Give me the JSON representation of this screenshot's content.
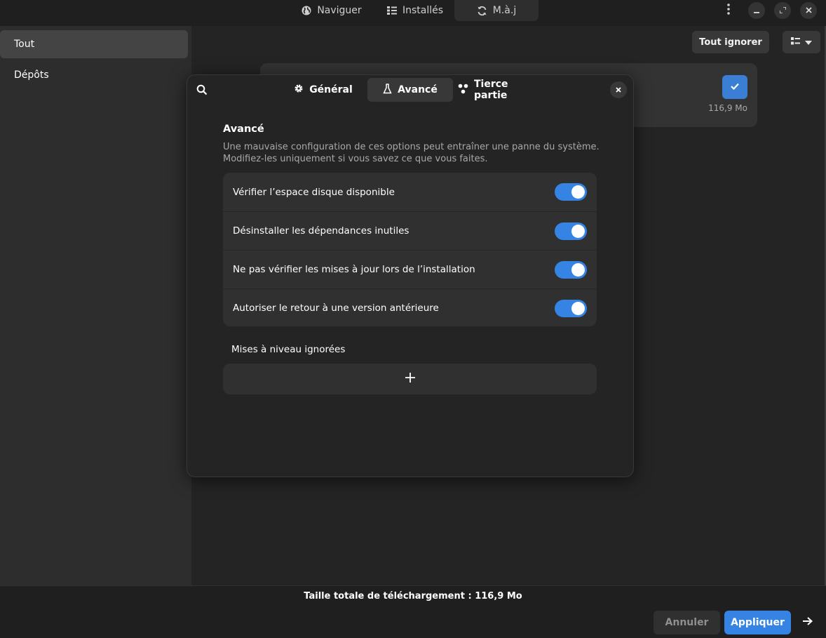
{
  "header": {
    "tabs": [
      {
        "label": "Naviguer",
        "icon": "globe-icon"
      },
      {
        "label": "Installés",
        "icon": "list-icon"
      },
      {
        "label": "M.à.j",
        "icon": "refresh-icon"
      }
    ],
    "active_tab": "M.à.j"
  },
  "sidebar": {
    "items": [
      {
        "label": "Tout",
        "selected": true
      },
      {
        "label": "Dépôts",
        "selected": false
      }
    ]
  },
  "main": {
    "ignore_all_label": "Tout ignorer",
    "view_mode_icon": "view-list-icon",
    "update_card": {
      "size": "116,9 Mo",
      "checked": true
    }
  },
  "dialog": {
    "tabs": [
      {
        "label": "Général",
        "icon": "gear-icon"
      },
      {
        "label": "Avancé",
        "icon": "flask-icon"
      },
      {
        "label": "Tierce partie",
        "icon": "nodes-icon"
      }
    ],
    "active_tab": "Avancé",
    "section_title": "Avancé",
    "section_desc_line1": "Une mauvaise configuration de ces options peut entraîner une panne du système.",
    "section_desc_line2": "Modifiez-les uniquement si vous savez ce que vous faites.",
    "options": [
      {
        "label": "Vérifier l’espace disque disponible",
        "enabled": true
      },
      {
        "label": "Désinstaller les dépendances inutiles",
        "enabled": true
      },
      {
        "label": "Ne pas vérifier les mises à jour lors de l’installation",
        "enabled": true
      },
      {
        "label": "Autoriser le retour à une version antérieure",
        "enabled": true
      }
    ],
    "ignored_title": "Mises à niveau ignorées"
  },
  "footer": {
    "total_label": "Taille totale de téléchargement : 116,9 Mo",
    "cancel_label": "Annuler",
    "apply_label": "Appliquer"
  },
  "colors": {
    "accent": "#3584e4",
    "window_bg": "#242424",
    "sidebar_bg": "#2d2d2d"
  }
}
